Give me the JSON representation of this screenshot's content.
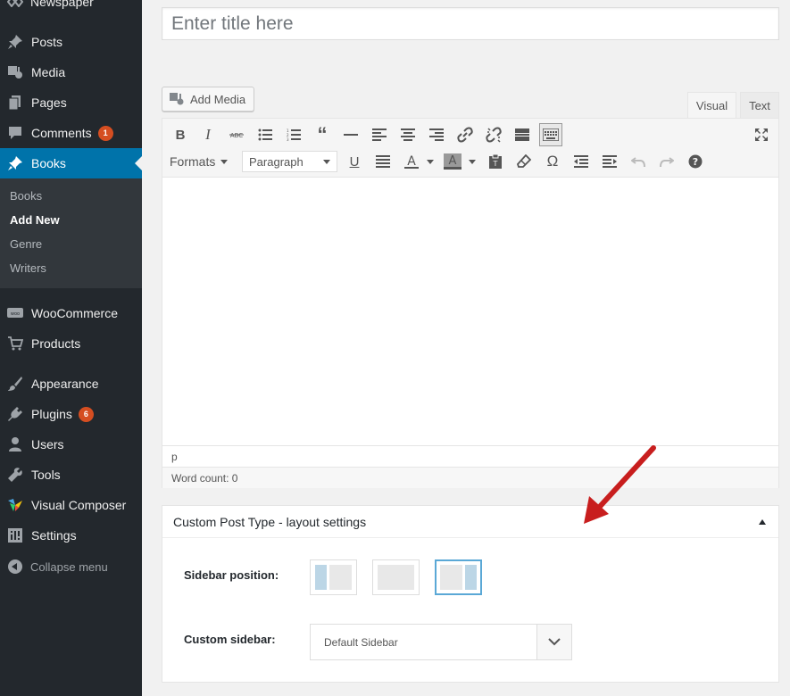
{
  "sidebar": {
    "top_item": "Newspaper",
    "items": [
      {
        "label": "Posts",
        "icon": "pushpin-icon"
      },
      {
        "label": "Media",
        "icon": "media-icon"
      },
      {
        "label": "Pages",
        "icon": "pages-icon"
      },
      {
        "label": "Comments",
        "icon": "comments-icon",
        "badge": "1"
      },
      {
        "label": "Books",
        "icon": "pushpin-icon",
        "active": true
      },
      {
        "label": "WooCommerce",
        "icon": "woo-icon"
      },
      {
        "label": "Products",
        "icon": "cart-icon"
      },
      {
        "label": "Appearance",
        "icon": "brush-icon"
      },
      {
        "label": "Plugins",
        "icon": "plug-icon",
        "badge": "6"
      },
      {
        "label": "Users",
        "icon": "user-icon"
      },
      {
        "label": "Tools",
        "icon": "wrench-icon"
      },
      {
        "label": "Visual Composer",
        "icon": "vc-icon"
      },
      {
        "label": "Settings",
        "icon": "settings-icon"
      }
    ],
    "submenu": [
      "Books",
      "Add New",
      "Genre",
      "Writers"
    ],
    "submenu_current": "Add New",
    "collapse": "Collapse menu"
  },
  "title": {
    "placeholder": "Enter title here",
    "value": ""
  },
  "add_media": "Add Media",
  "tabs": {
    "visual": "Visual",
    "text": "Text"
  },
  "toolbar": {
    "formats": "Formats",
    "paragraph": "Paragraph"
  },
  "editor": {
    "path": "p",
    "word_count": "Word count: 0"
  },
  "metabox": {
    "title": "Custom Post Type - layout settings",
    "sidebar_position_label": "Sidebar position:",
    "custom_sidebar_label": "Custom sidebar:",
    "custom_sidebar_value": "Default Sidebar",
    "selected_layout": "right-sidebar"
  },
  "colors": {
    "admin_bar": "#23282d",
    "active": "#0073aa",
    "badge": "#d54e21",
    "arrow": "#e02020",
    "selected_layout": "#5aa8d6"
  }
}
